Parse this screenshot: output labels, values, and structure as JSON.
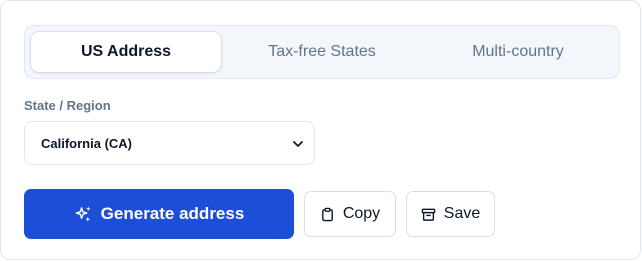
{
  "tabs": [
    {
      "label": "US Address",
      "active": true
    },
    {
      "label": "Tax-free States",
      "active": false
    },
    {
      "label": "Multi-country",
      "active": false
    }
  ],
  "state_field": {
    "label": "State / Region",
    "selected": "California (CA)"
  },
  "actions": {
    "generate_label": "Generate address",
    "generate_icon": "sparkles-icon",
    "copy_label": "Copy",
    "copy_icon": "clipboard-icon",
    "save_label": "Save",
    "save_icon": "archive-box-icon"
  },
  "colors": {
    "primary": "#1d4ed8",
    "tab_track": "#f3f6fa",
    "muted_text": "#64748b"
  }
}
